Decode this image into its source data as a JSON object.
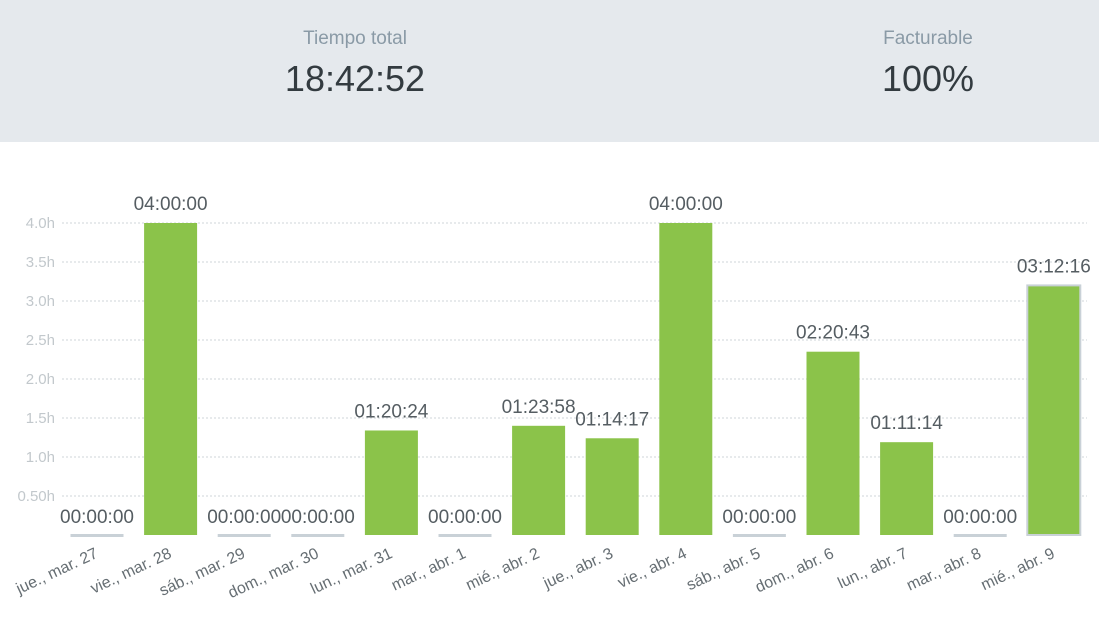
{
  "summary": {
    "total_label": "Tiempo total",
    "total_value": "18:42:52",
    "billable_label": "Facturable",
    "billable_value": "100%"
  },
  "chart_data": {
    "type": "bar",
    "categories": [
      "jue., mar. 27",
      "vie., mar. 28",
      "sáb., mar. 29",
      "dom., mar. 30",
      "lun., mar. 31",
      "mar., abr. 1",
      "mié., abr. 2",
      "jue., abr. 3",
      "vie., abr. 4",
      "sáb., abr. 5",
      "dom., abr. 6",
      "lun., abr. 7",
      "mar., abr. 8",
      "mié., abr. 9"
    ],
    "values": [
      0,
      4.0,
      0,
      0,
      1.34,
      0,
      1.4,
      1.24,
      4.0,
      0,
      2.35,
      1.19,
      0,
      3.2
    ],
    "data_labels": [
      "00:00:00",
      "04:00:00",
      "00:00:00",
      "00:00:00",
      "01:20:24",
      "00:00:00",
      "01:23:58",
      "01:14:17",
      "04:00:00",
      "00:00:00",
      "02:20:43",
      "01:11:14",
      "00:00:00",
      "03:12:16"
    ],
    "yticks": [
      "0.50h",
      "1.0h",
      "1.5h",
      "2.0h",
      "2.5h",
      "3.0h",
      "3.5h",
      "4.0h"
    ],
    "ytick_values": [
      0.5,
      1.0,
      1.5,
      2.0,
      2.5,
      3.0,
      3.5,
      4.0
    ],
    "ylim": [
      0,
      4.0
    ],
    "grid": true,
    "bar_color": "#8bc34a",
    "zero_bar_color": "#c9d1d7"
  }
}
